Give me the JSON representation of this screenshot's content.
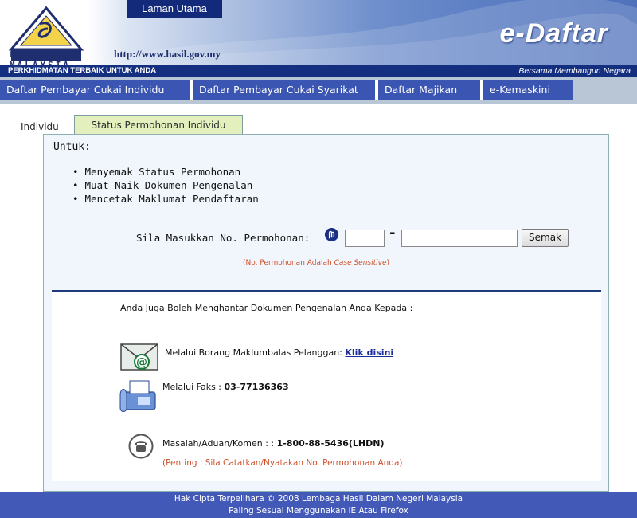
{
  "header": {
    "logo_text": "LHDN MALAYSIA",
    "home_link": "Laman Utama",
    "url": "http://www.hasil.gov.my",
    "brand": "e-Daftar",
    "tagline_left": "PERKHIDMATAN TERBAIK UNTUK ANDA",
    "tagline_right": "Bersama Membangun Negara"
  },
  "nav": {
    "items": [
      {
        "label": "Daftar Pembayar Cukai Individu"
      },
      {
        "label": "Daftar Pembayar Cukai Syarikat"
      },
      {
        "label": "Daftar Majikan"
      },
      {
        "label": "e-Kemaskini"
      }
    ]
  },
  "tabs": [
    {
      "label": "Individu",
      "active": false
    },
    {
      "label": "Status Permohonan Individu",
      "active": true
    }
  ],
  "content": {
    "intro": "Untuk:",
    "bullets": [
      "Menyemak Status Permohonan",
      "Muat Naik Dokumen Pengenalan",
      "Mencetak Maklumat Pendaftaran"
    ],
    "form": {
      "label": "Sila Masukkan No. Permohonan:",
      "input1_value": "",
      "separator": "-",
      "input2_value": "",
      "button": "Semak",
      "note_prefix": "(No. Permohonan Adalah ",
      "note_emphasis": "Case Sensitive",
      "note_suffix": ")"
    },
    "contact": {
      "heading": "Anda Juga Boleh Menghantar Dokumen Pengenalan Anda Kepada :",
      "email_text": "Melalui Borang Maklumbalas Pelanggan: ",
      "email_link": "Klik disini",
      "fax_label": "Melalui Faks : ",
      "fax_number": "03-77136363",
      "phone_label": "Masalah/Aduan/Komen : : ",
      "phone_number": "1-800-88-5436(LHDN)",
      "important": "(Penting : Sila Catatkan/Nyatakan No. Permohonan Anda)"
    }
  },
  "footer": {
    "line1": "Hak Cipta Terpelihara © 2008 Lembaga Hasil Dalam Negeri Malaysia",
    "line2": "Paling Sesuai Menggunakan IE Atau Firefox"
  },
  "colors": {
    "header_dark": "#142e80",
    "nav_button": "#3a55b2",
    "tab_active": "#e3f0be",
    "panel_bg": "#f0f6fb",
    "note": "#d0502a",
    "footer_bg": "#4259b8"
  }
}
